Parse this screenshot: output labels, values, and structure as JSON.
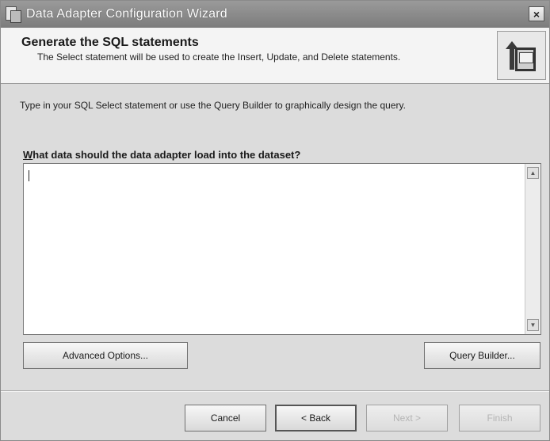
{
  "window": {
    "title": "Data Adapter Configuration Wizard",
    "close_label": "×"
  },
  "header": {
    "title": "Generate the SQL statements",
    "description": "The Select statement will be used to create the Insert, Update, and Delete statements."
  },
  "body": {
    "instruction": "Type in your SQL Select statement or use the Query Builder to graphically design the query.",
    "question_first_letter": "W",
    "question_rest": "hat data should the data adapter load into the dataset?",
    "sql_text": ""
  },
  "buttons": {
    "advanced_options": "Advanced Options...",
    "query_builder": "Query Builder...",
    "cancel": "Cancel",
    "back": "< Back",
    "next": "Next >",
    "finish": "Finish"
  },
  "scroll": {
    "up_glyph": "▲",
    "down_glyph": "▼"
  }
}
